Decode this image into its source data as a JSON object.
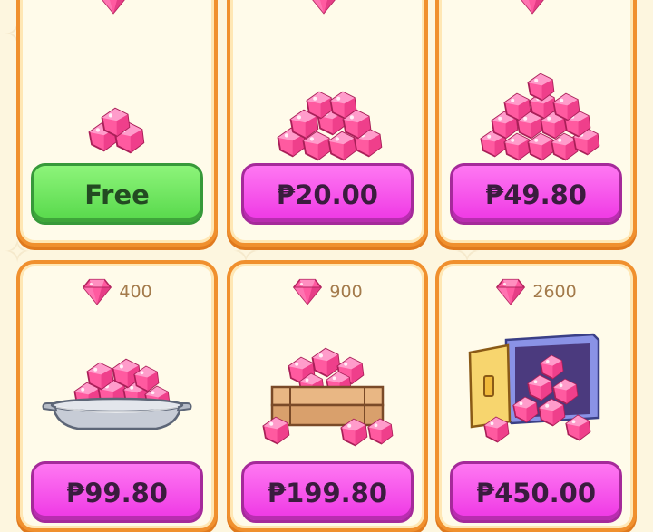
{
  "packs": [
    {
      "amount": "",
      "price": "Free",
      "style": "free",
      "art": "small-gem-pile-icon"
    },
    {
      "amount": "",
      "price": "₱20.00",
      "style": "buy",
      "art": "medium-gem-pile-icon"
    },
    {
      "amount": "",
      "price": "₱49.80",
      "style": "buy",
      "art": "large-gem-pile-icon"
    },
    {
      "amount": "400",
      "price": "₱99.80",
      "style": "buy",
      "art": "gem-bowl-icon"
    },
    {
      "amount": "900",
      "price": "₱199.80",
      "style": "buy",
      "art": "gem-crate-icon"
    },
    {
      "amount": "2600",
      "price": "₱450.00",
      "style": "buy",
      "art": "gem-vault-icon"
    }
  ],
  "colors": {
    "background": "#fdf6df",
    "card_border": "#f0902e",
    "buy_button": "#ee36e4",
    "free_button": "#56d84a",
    "gem": "#ff5aa0"
  }
}
